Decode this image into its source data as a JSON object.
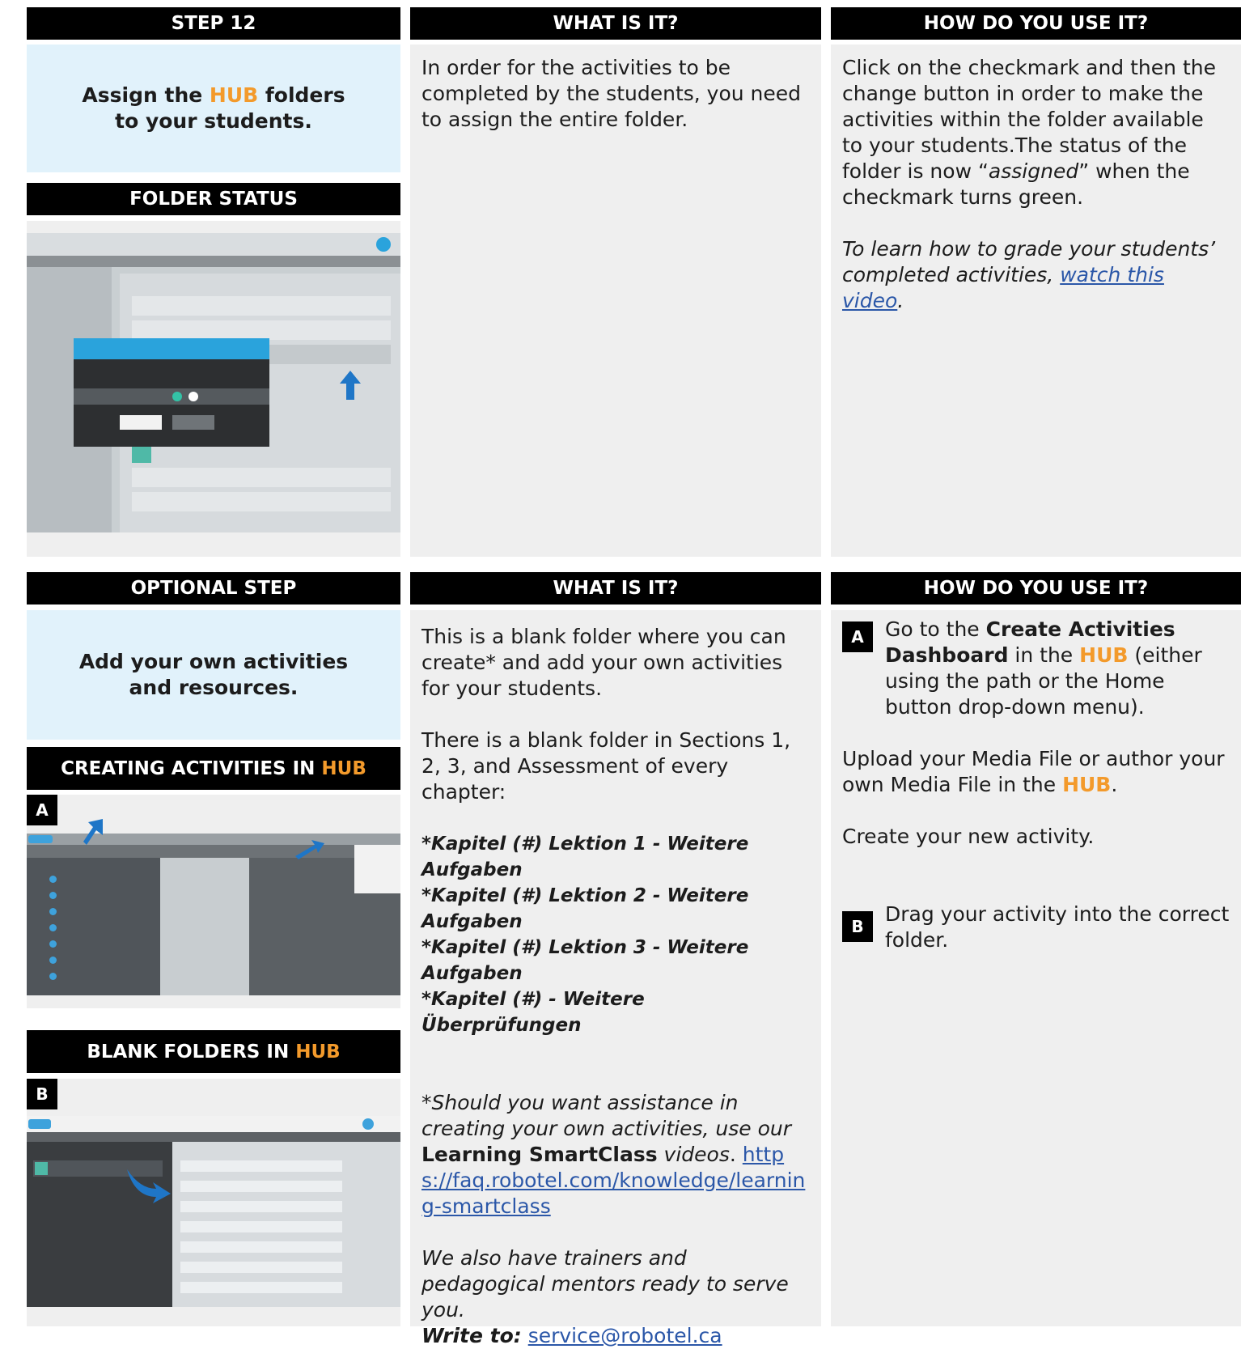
{
  "colors": {
    "hub_accent": "#f39a2b",
    "link": "#2b57a8",
    "header_bg": "#000000",
    "step_bg": "#e1f2fb",
    "panel_bg": "#efefef"
  },
  "top": {
    "step_header": "STEP 12",
    "step_title_pre": "Assign the ",
    "step_title_hub": "HUB",
    "step_title_post_1": " folders",
    "step_title_line2": "to your students.",
    "folder_status_header": "FOLDER STATUS",
    "what_header": "WHAT IS IT?",
    "what_text": "In order for the activities to be completed by the students, you need to assign the entire folder.",
    "how_header": "HOW DO YOU USE IT?",
    "how_text_1": "Click on the checkmark and then the change button in order to make the activities within the folder available to your students.The status of the folder is now “",
    "how_text_assigned": "assigned",
    "how_text_2": "” when the checkmark turns green.",
    "how_italic_1": "To learn how to grade your students’ completed activities, ",
    "how_link": "watch this video",
    "how_italic_2": "."
  },
  "bottom": {
    "step_header": "OPTIONAL STEP",
    "step_title_line1": "Add your own activities",
    "step_title_line2": "and resources.",
    "creating_header_pre": "CREATING ACTIVITIES IN ",
    "creating_header_hub": "HUB",
    "badge_a": "A",
    "blank_header_pre": "BLANK FOLDERS IN ",
    "blank_header_hub": "HUB",
    "badge_b": "B",
    "what_header": "WHAT IS IT?",
    "what_p1": "This is a blank folder where you can create* and add your own activities for your students.",
    "what_p2": "There is a blank folder in Sections 1, 2, 3, and Assessment of every chapter:",
    "folders": [
      "*Kapitel (#) Lektion 1 - Weitere Aufgaben",
      "*Kapitel (#) Lektion 2 - Weitere Aufgaben",
      "*Kapitel (#) Lektion 3 - Weitere Aufgaben",
      "*Kapitel (#) - Weitere Überprüfungen"
    ],
    "note_star": "*",
    "note_italic": "Should you want assistance in creating your own activities, use our ",
    "note_bold": "Learning SmartClass",
    "note_italic_2": " videos",
    "note_dot": ". ",
    "note_link": "https://faq.robotel.com/knowledge/learning-smartclass",
    "trainers_1": "We also have trainers and pedagogical mentors ready to serve you.",
    "write_to": "Write to:",
    "email": "service@robotel.ca",
    "how_header": "HOW DO YOU USE IT?",
    "how_a_1": "Go to the ",
    "how_a_bold": "Create Activities Dashboard",
    "how_a_2": " in the ",
    "how_a_hub": "HUB",
    "how_a_3": " (either using the path or the Home button drop-down menu).",
    "upload_1": "Upload your Media File or author your own Media File in the ",
    "upload_hub": "HUB",
    "upload_2": ".",
    "create_text": "Create your new activity.",
    "how_b_text": "Drag your activity into the correct folder."
  }
}
